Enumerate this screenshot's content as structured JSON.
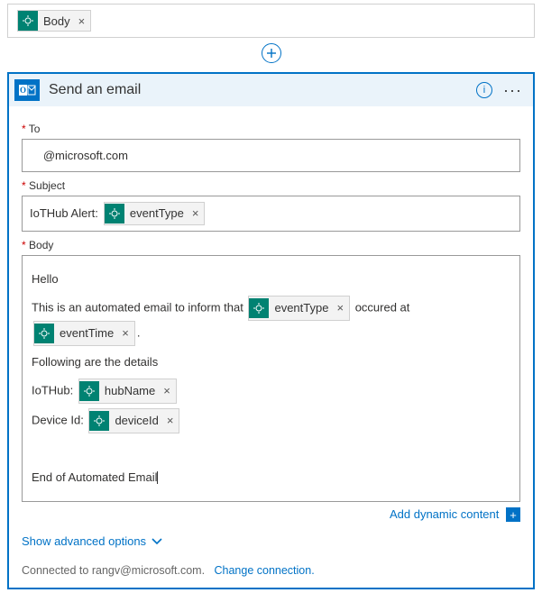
{
  "top_token": "Body",
  "card": {
    "title": "Send an email",
    "fields": {
      "to": {
        "label": "To",
        "value": "@microsoft.com"
      },
      "subject": {
        "label": "Subject",
        "prefix": "IoTHub Alert:",
        "tokens": [
          "eventType"
        ]
      },
      "body": {
        "label": "Body",
        "line_hello": "Hello",
        "line_intro_before": "This is an automated email to inform that",
        "line_intro_mid": "occured at",
        "line_details": "Following are the details",
        "line_iothub_label": "IoTHub:",
        "line_device_label": "Device Id:",
        "line_end": "End of Automated Email",
        "tokens": {
          "eventType": "eventType",
          "eventTime": "eventTime",
          "hubName": "hubName",
          "deviceId": "deviceId"
        }
      }
    },
    "dynamic_content": "Add dynamic content",
    "advanced": "Show advanced options",
    "footer_connected_to": "Connected to rangv@microsoft.com.",
    "footer_change": "Change connection."
  }
}
